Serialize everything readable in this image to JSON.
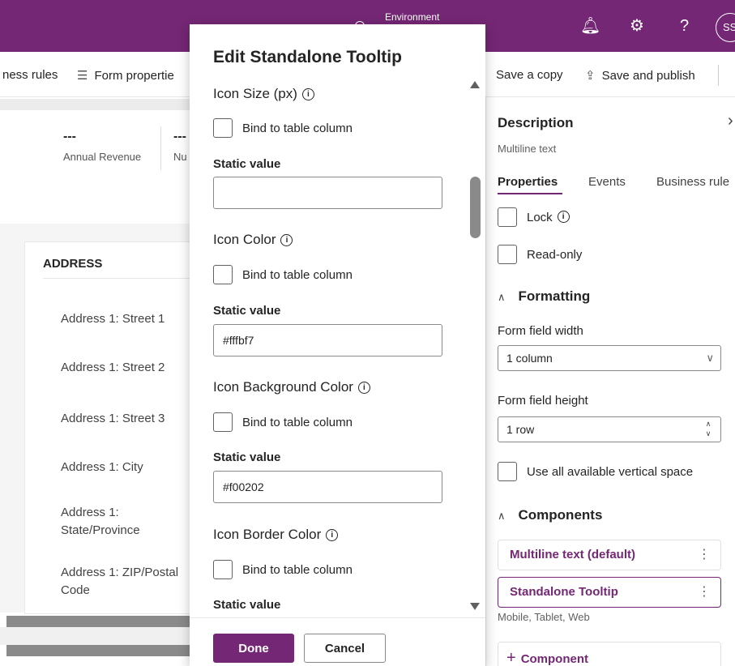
{
  "topbar": {
    "environment_label": "Environment",
    "avatar_initials": "SS"
  },
  "commandbar": {
    "business_rules": "ness rules",
    "form_properties": "Form propertie",
    "save_copy": "Save a copy",
    "save_publish": "Save and publish"
  },
  "summary": {
    "field1_value": "---",
    "field1_label": "Annual Revenue",
    "field2_value": "---",
    "field2_label": "Nu"
  },
  "address_card": {
    "title": "ADDRESS",
    "fields": [
      "Address 1: Street 1",
      "Address 1: Street 2",
      "Address 1: Street 3",
      "Address 1: City",
      "Address 1: State/Province",
      "Address 1: ZIP/Postal Code"
    ]
  },
  "dialog": {
    "title": "Edit Standalone Tooltip",
    "sections": [
      {
        "heading": "Icon Size (px)",
        "bind_label": "Bind to table column",
        "static_label": "Static value",
        "static_value": ""
      },
      {
        "heading": "Icon Color",
        "bind_label": "Bind to table column",
        "static_label": "Static value",
        "static_value": "#fffbf7"
      },
      {
        "heading": "Icon Background Color",
        "bind_label": "Bind to table column",
        "static_label": "Static value",
        "static_value": "#f00202"
      },
      {
        "heading": "Icon Border Color",
        "bind_label": "Bind to table column",
        "static_label": "Static value"
      }
    ],
    "done_label": "Done",
    "cancel_label": "Cancel"
  },
  "pane": {
    "title": "Description",
    "subtitle": "Multiline text",
    "tabs": [
      "Properties",
      "Events",
      "Business rule"
    ],
    "lock_label": "Lock",
    "readonly_label": "Read-only",
    "formatting_heading": "Formatting",
    "width_label": "Form field width",
    "width_value": "1 column",
    "height_label": "Form field height",
    "height_value": "1 row",
    "vertical_space_label": "Use all available vertical space",
    "components_heading": "Components",
    "components": [
      "Multiline text (default)",
      "Standalone Tooltip"
    ],
    "component_caption": "Mobile, Tablet, Web",
    "add_component_label": "Component"
  },
  "icons": [
    "bell-icon",
    "gear-icon",
    "help-icon",
    "info-icon",
    "checkbox-icon",
    "chevron-down-icon",
    "close-icon",
    "more-icon",
    "plus-icon",
    "form-icon",
    "publish-icon"
  ],
  "colors": {
    "brand": "#742774",
    "dialog_bg": "#ffffff",
    "scrollbar": "#8a8a8a"
  }
}
